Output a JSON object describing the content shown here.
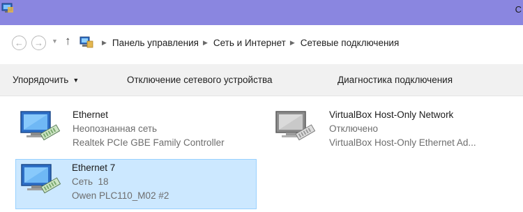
{
  "window": {
    "title": "С",
    "app_icon": "network-connections-icon"
  },
  "nav": {
    "back_icon": "back-arrow-icon",
    "forward_icon": "forward-arrow-icon",
    "up_icon": "up-arrow-icon",
    "breadcrumb": [
      "Панель управления",
      "Сеть и Интернет",
      "Сетевые подключения"
    ]
  },
  "toolbar": {
    "organize": "Упорядочить",
    "disable": "Отключение сетевого устройства",
    "diagnose": "Диагностика подключения"
  },
  "connections": [
    {
      "name": "Ethernet",
      "status": "Неопознанная сеть",
      "adapter": "Realtek PCIe GBE Family Controller",
      "icon": "network-adapter-icon",
      "selected": false,
      "disabled": false
    },
    {
      "name": "VirtualBox Host-Only Network",
      "status": "Отключено",
      "adapter": "VirtualBox Host-Only Ethernet Ad...",
      "icon": "network-adapter-disabled-icon",
      "selected": false,
      "disabled": true
    },
    {
      "name": "Ethernet 7",
      "status": "Сеть  18",
      "adapter": "Owen PLC110_M02 #2",
      "icon": "network-adapter-icon",
      "selected": true,
      "disabled": false
    }
  ],
  "colors": {
    "titlebar": "#8a86e0",
    "command_bar": "#f1f1f1",
    "selection": "#cce8ff",
    "selection_border": "#99d1ff"
  }
}
